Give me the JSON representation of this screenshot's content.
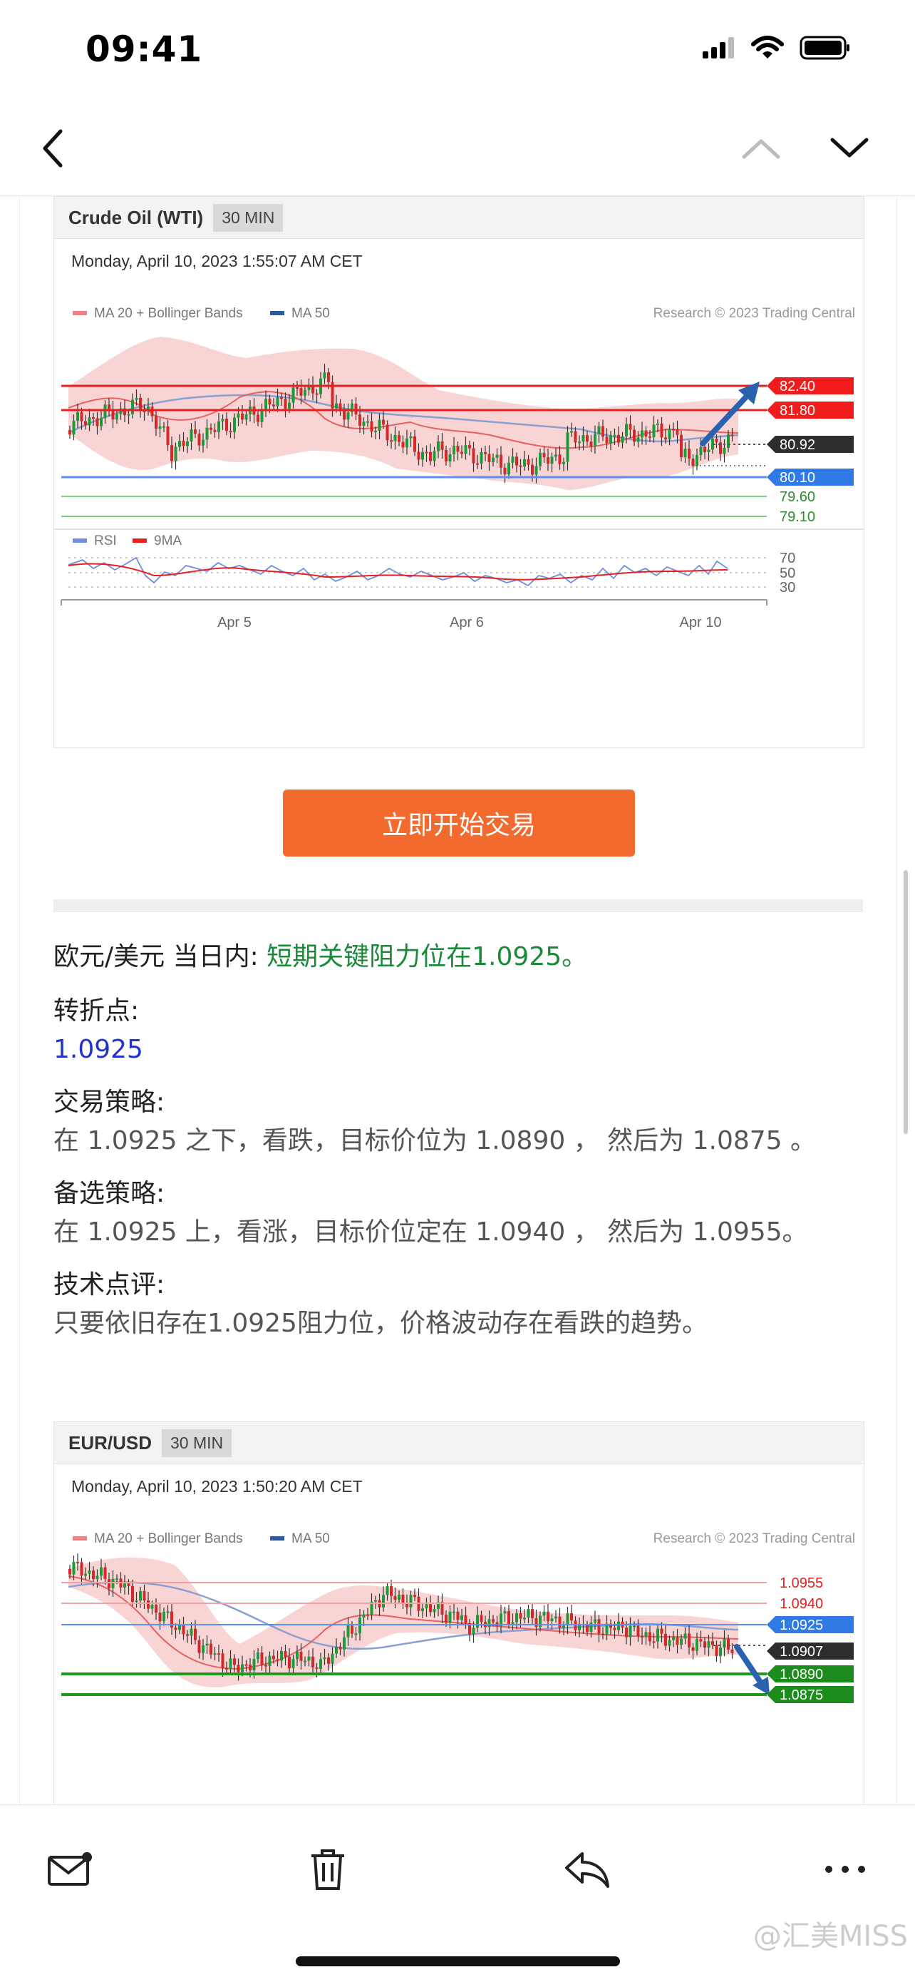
{
  "status": {
    "time": "09:41"
  },
  "nav": {
    "back_icon": "chevron-left-icon",
    "prev_icon": "chevron-up-icon",
    "next_icon": "chevron-down-icon"
  },
  "charts": [
    {
      "symbol": "Crude Oil (WTI)",
      "timeframe": "30 MIN",
      "datetime": "Monday, April 10, 2023 1:55:07 AM CET",
      "legend": {
        "ma20": "MA 20 + Bollinger Bands",
        "ma50": "MA 50",
        "credit": "Research © 2023 Trading Central"
      },
      "levels": [
        "82.40",
        "81.80",
        "80.92",
        "80.10",
        "79.60",
        "79.10"
      ],
      "rsi_legend": {
        "rsi": "RSI",
        "ma": "9MA"
      },
      "rsi_levels": [
        "70",
        "50",
        "30"
      ],
      "xlabels": [
        "Apr 5",
        "Apr 6",
        "Apr 10"
      ]
    },
    {
      "symbol": "EUR/USD",
      "timeframe": "30 MIN",
      "datetime": "Monday, April 10, 2023 1:50:20 AM CET",
      "legend": {
        "ma20": "MA 20 + Bollinger Bands",
        "ma50": "MA 50",
        "credit": "Research © 2023 Trading Central"
      },
      "levels": [
        "1.0955",
        "1.0940",
        "1.0925",
        "1.0907",
        "1.0890",
        "1.0875"
      ]
    }
  ],
  "cta": {
    "label": "立即开始交易"
  },
  "article": {
    "headline_prefix": "欧元/美元 当日内: ",
    "headline_highlight": "短期关键阻力位在1.0925。",
    "pivot_label": "转折点:",
    "pivot_value": "1.0925",
    "strategy_label": "交易策略:",
    "strategy_text": "在 1.0925 之下，看跌，目标价位为 1.0890 ， 然后为 1.0875 。",
    "alt_label": "备选策略:",
    "alt_text": "在 1.0925 上，看涨，目标价位定在 1.0940 ， 然后为 1.0955。",
    "comment_label": "技术点评:",
    "comment_text": "只要依旧存在1.0925阻力位，价格波动存在看跌的趋势。"
  },
  "toolbar": {
    "mail_icon": "mail-icon",
    "trash_icon": "trash-icon",
    "reply_icon": "reply-icon",
    "more_icon": "more-icon"
  },
  "watermark": "@汇美MISS"
}
